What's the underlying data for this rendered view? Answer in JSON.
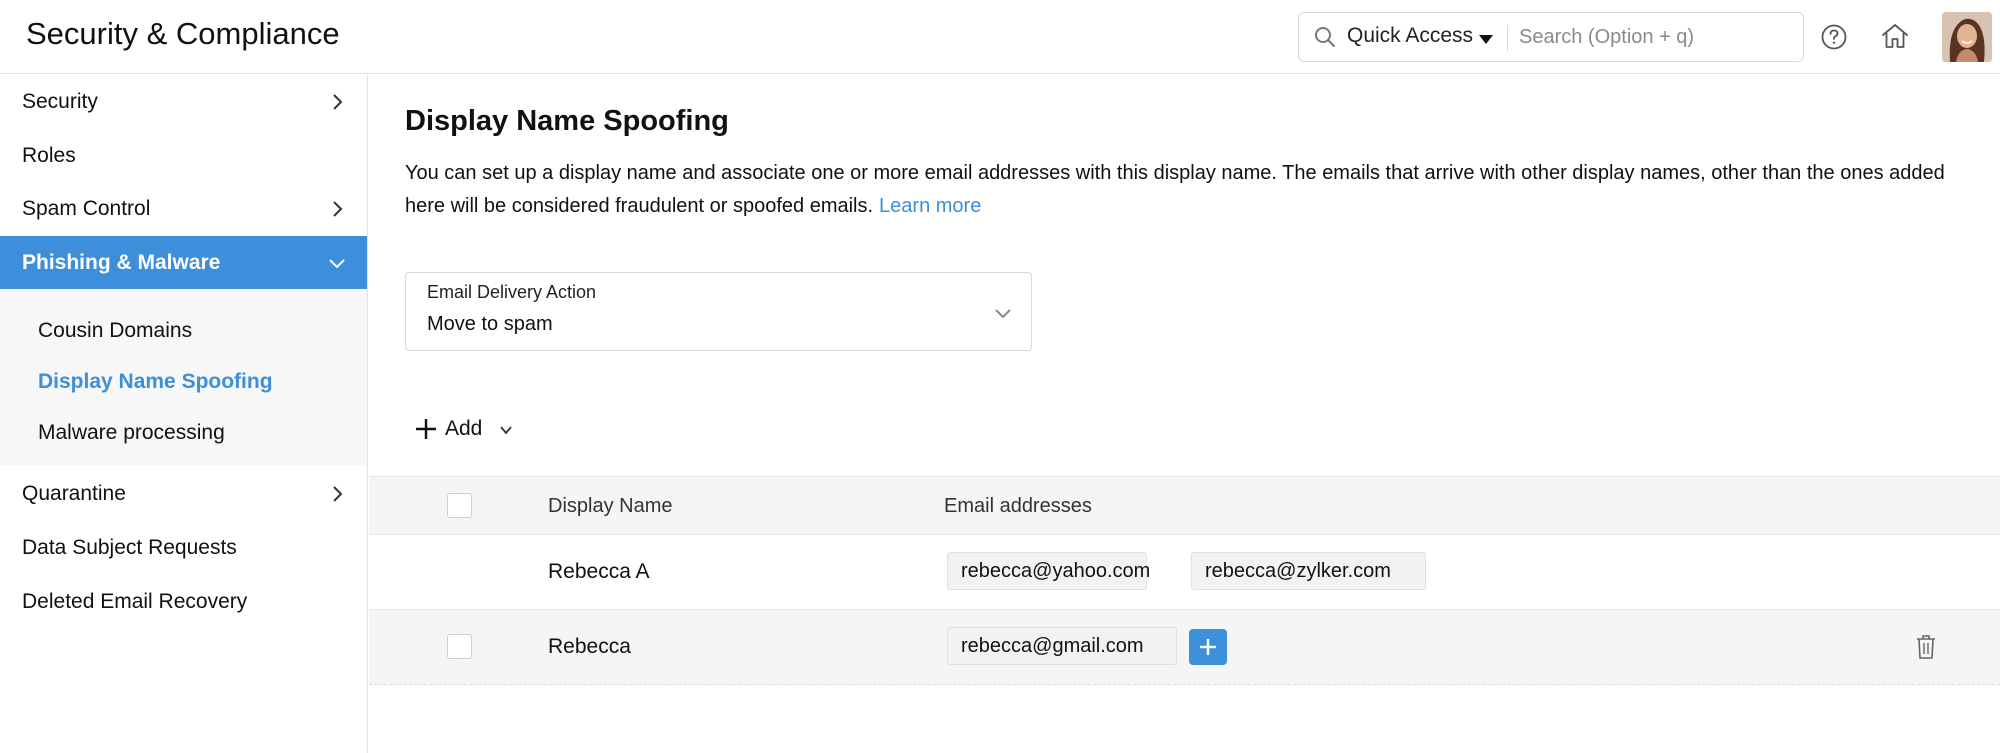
{
  "header": {
    "title": "Security & Compliance",
    "quick_access_label": "Quick Access",
    "search_placeholder": "Search (Option + q)",
    "icons": [
      "search-icon",
      "caret-down-icon",
      "help-icon",
      "home-icon",
      "avatar"
    ]
  },
  "sidebar": {
    "items": [
      {
        "label": "Security",
        "has_chevron": true
      },
      {
        "label": "Roles",
        "has_chevron": false
      },
      {
        "label": "Spam Control",
        "has_chevron": true
      },
      {
        "label": "Phishing & Malware",
        "expanded": true,
        "active": true
      },
      {
        "label": "Quarantine",
        "has_chevron": true
      },
      {
        "label": "Data Subject Requests",
        "has_chevron": false
      },
      {
        "label": "Deleted Email Recovery",
        "has_chevron": false
      }
    ],
    "subitems": [
      {
        "label": "Cousin Domains"
      },
      {
        "label": "Display Name Spoofing",
        "active": true
      },
      {
        "label": "Malware processing"
      }
    ]
  },
  "main": {
    "title": "Display Name Spoofing",
    "description": "You can set up a display name and associate one or more email addresses with this display name. The emails that arrive with other display names, other than the ones added here will be considered fraudulent or spoofed emails.",
    "learn_more": "Learn more",
    "delivery_action": {
      "label": "Email Delivery Action",
      "value": "Move to spam"
    },
    "add_label": "Add",
    "table": {
      "headers": [
        "Display Name",
        "Email addresses"
      ],
      "rows": [
        {
          "name": "Rebecca A",
          "emails": [
            "rebecca@yahoo.com",
            "rebecca@zylker.com"
          ]
        },
        {
          "name": "Rebecca",
          "emails": [
            "rebecca@gmail.com"
          ]
        }
      ]
    }
  },
  "colors": {
    "accent": "#3d8fdb",
    "header_row_bg": "#f4f5f7",
    "chip_bg": "#f2f2f2"
  }
}
